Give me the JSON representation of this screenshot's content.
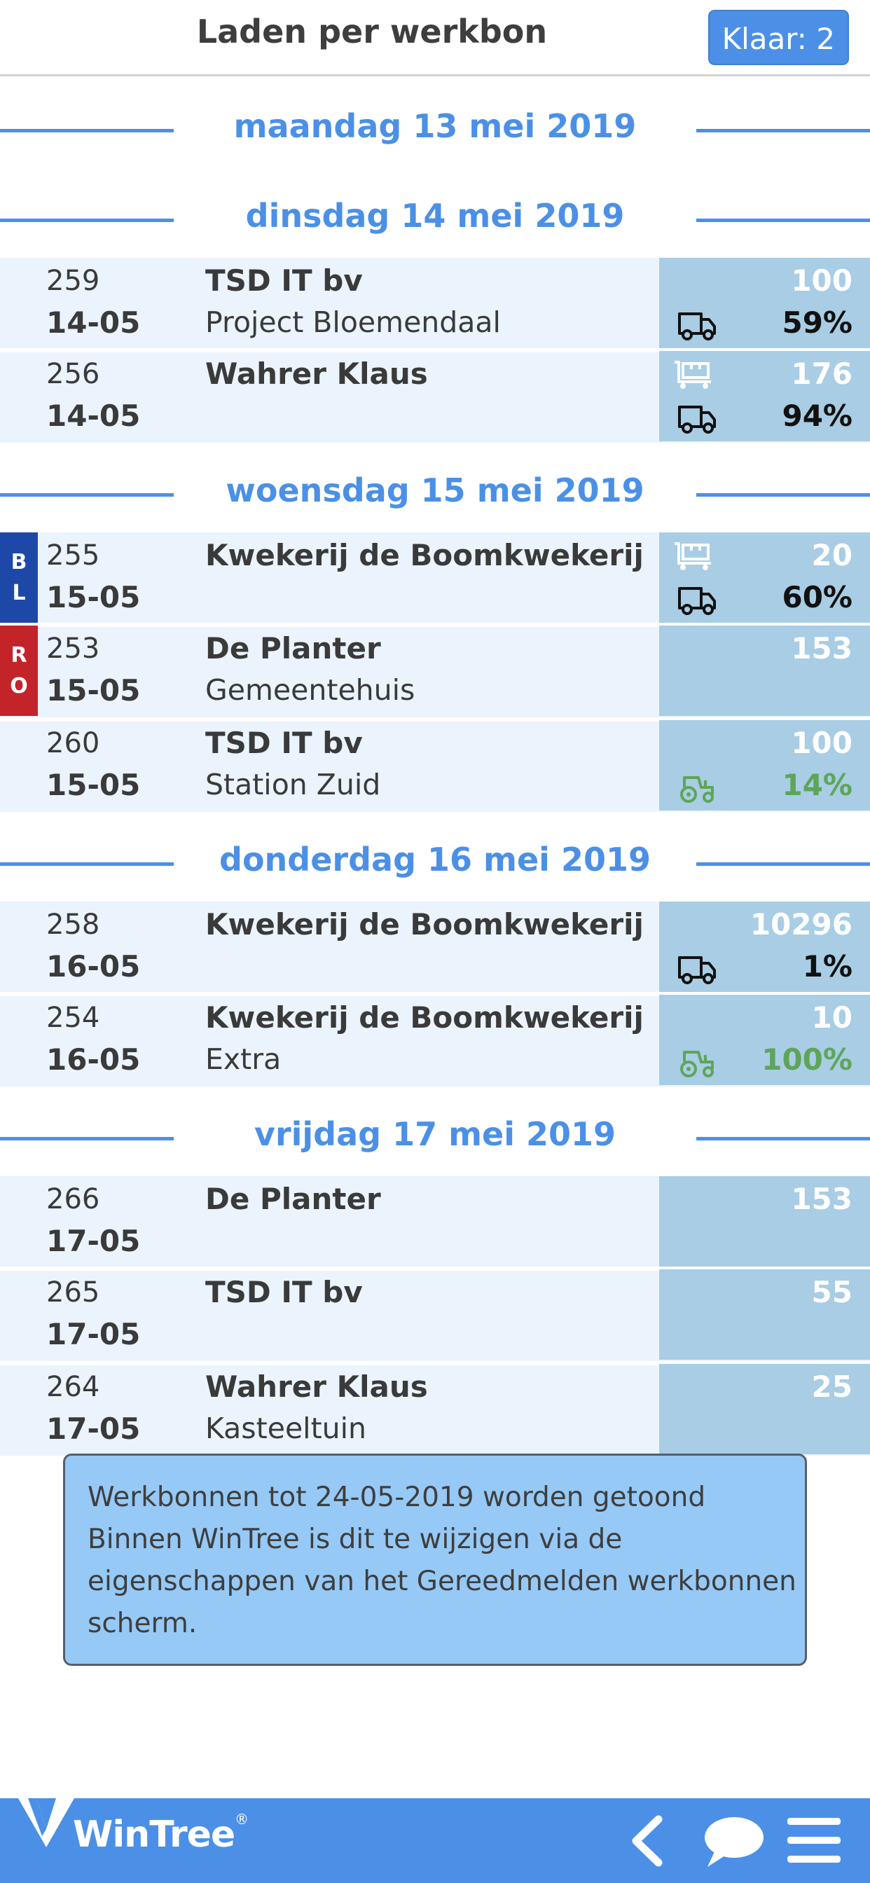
{
  "header": {
    "title": "Laden per werkbon",
    "ready_button": "Klaar: 2"
  },
  "days": [
    {
      "label": "maandag 13 mei 2019",
      "orders": []
    },
    {
      "label": "dinsdag 14 mei 2019",
      "orders": [
        {
          "number": "259",
          "date": "14-05",
          "client": "TSD IT bv",
          "project": "Project Bloemendaal",
          "quantity": "100",
          "percent": "59%",
          "icon_top": "",
          "icon_bottom": "truck-icon",
          "percent_color": "#111111",
          "tag": null
        },
        {
          "number": "256",
          "date": "14-05",
          "client": "Wahrer Klaus",
          "project": "",
          "quantity": "176",
          "percent": "94%",
          "icon_top": "cart-icon",
          "icon_bottom": "truck-icon",
          "percent_color": "#111111",
          "tag": null
        }
      ]
    },
    {
      "label": "woensdag 15 mei 2019",
      "orders": [
        {
          "number": "255",
          "date": "15-05",
          "client": "Kwekerij de Boomkwekerij",
          "project": "",
          "quantity": "20",
          "percent": "60%",
          "icon_top": "cart-icon",
          "icon_bottom": "truck-icon",
          "percent_color": "#111111",
          "tag": {
            "letters": [
              "B",
              "L"
            ],
            "color": "#1e48a8"
          }
        },
        {
          "number": "253",
          "date": "15-05",
          "client": "De Planter",
          "project": "Gemeentehuis",
          "quantity": "153",
          "percent": "",
          "icon_top": "",
          "icon_bottom": "",
          "percent_color": "#111111",
          "tag": {
            "letters": [
              "R",
              "O"
            ],
            "color": "#c2242a"
          }
        },
        {
          "number": "260",
          "date": "15-05",
          "client": "TSD IT bv",
          "project": "Station Zuid",
          "quantity": "100",
          "percent": "14%",
          "icon_top": "",
          "icon_bottom": "tractor-icon",
          "percent_color": "#5ea55a",
          "tag": null
        }
      ]
    },
    {
      "label": "donderdag 16 mei 2019",
      "orders": [
        {
          "number": "258",
          "date": "16-05",
          "client": "Kwekerij de Boomkwekerij",
          "project": "",
          "quantity": "10296",
          "percent": "1%",
          "icon_top": "",
          "icon_bottom": "truck-icon",
          "percent_color": "#111111",
          "tag": null
        },
        {
          "number": "254",
          "date": "16-05",
          "client": "Kwekerij de Boomkwekerij",
          "project": "Extra",
          "quantity": "10",
          "percent": "100%",
          "icon_top": "",
          "icon_bottom": "tractor-icon",
          "percent_color": "#5ea55a",
          "tag": null
        }
      ]
    },
    {
      "label": "vrijdag 17 mei 2019",
      "orders": [
        {
          "number": "266",
          "date": "17-05",
          "client": "De Planter",
          "project": "",
          "quantity": "153",
          "percent": "",
          "icon_top": "",
          "icon_bottom": "",
          "percent_color": "#111111",
          "tag": null
        },
        {
          "number": "265",
          "date": "17-05",
          "client": "TSD IT bv",
          "project": "",
          "quantity": "55",
          "percent": "",
          "icon_top": "",
          "icon_bottom": "",
          "percent_color": "#111111",
          "tag": null
        },
        {
          "number": "264",
          "date": "17-05",
          "client": "Wahrer Klaus",
          "project": "Kasteeltuin",
          "quantity": "25",
          "percent": "",
          "icon_top": "",
          "icon_bottom": "",
          "percent_color": "#111111",
          "tag": null
        }
      ]
    }
  ],
  "info": {
    "lines": [
      "Werkbonnen tot 24-05-2019 worden getoond",
      "Binnen WinTree is dit te wijzigen via de",
      "eigenschappen van het Gereedmelden werkbonnen",
      "scherm."
    ]
  },
  "footer": {
    "logo_text": "WinTree",
    "logo_mark": "®",
    "nav_icons": [
      "back-icon",
      "chat-icon",
      "menu-icon"
    ]
  },
  "colors": {
    "accent": "#4b90e6",
    "row_bg": "#ebf4fd",
    "panel_bg": "#a8cde4",
    "green": "#5ea55a"
  }
}
